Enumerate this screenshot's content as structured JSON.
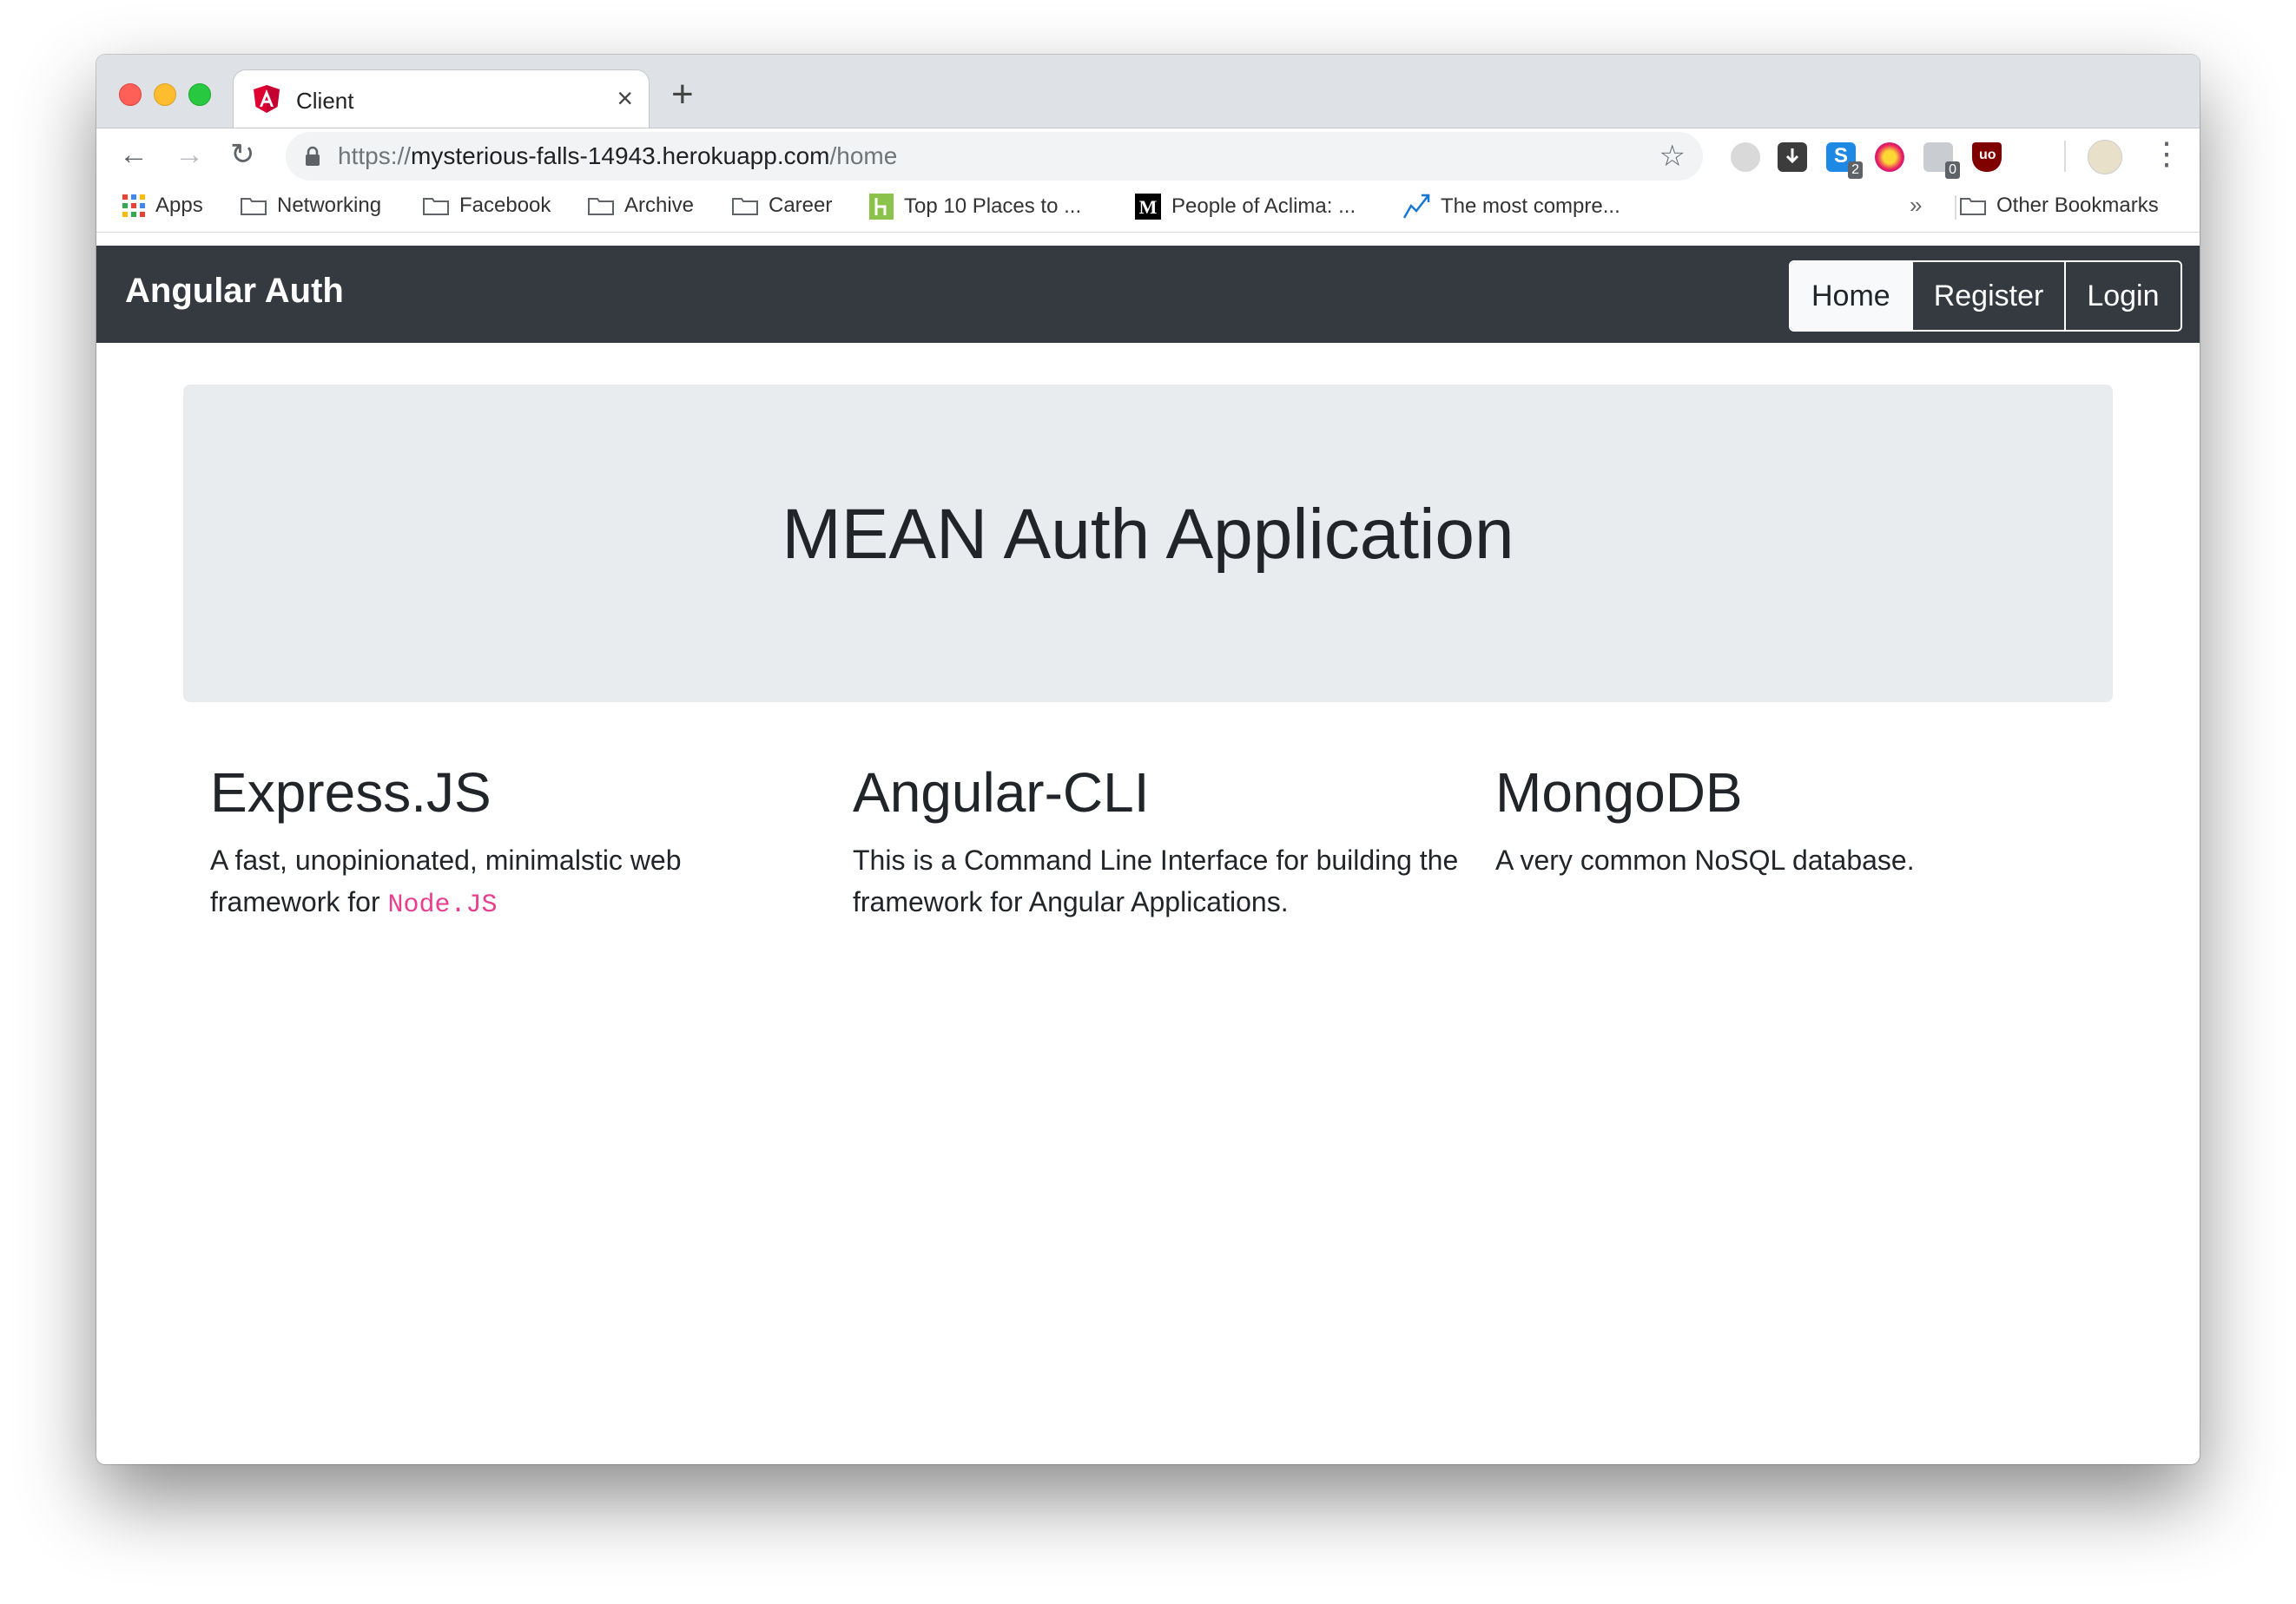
{
  "browser": {
    "tab_title": "Client",
    "tab_close": "×",
    "new_tab": "+",
    "url_scheme": "https://",
    "url_host": "mysterious-falls-14943.herokuapp.com",
    "url_path": "/home",
    "extension_badges": {
      "s": "2",
      "hands": "0"
    },
    "menu": "⋮"
  },
  "bookmarks": {
    "items": [
      {
        "label": "Apps",
        "icon": "apps-grid-icon"
      },
      {
        "label": "Networking",
        "icon": "folder-icon"
      },
      {
        "label": "Facebook",
        "icon": "folder-icon"
      },
      {
        "label": "Archive",
        "icon": "folder-icon"
      },
      {
        "label": "Career",
        "icon": "folder-icon"
      },
      {
        "label": "Top 10 Places to ...",
        "icon": "h-logo-icon"
      },
      {
        "label": "People of Aclima: ...",
        "icon": "medium-logo-icon"
      },
      {
        "label": "The most compre...",
        "icon": "chart-line-icon"
      }
    ],
    "overflow": "»",
    "other": "Other Bookmarks"
  },
  "navbar": {
    "brand": "Angular Auth",
    "links": [
      "Home",
      "Register",
      "Login"
    ]
  },
  "jumbotron": {
    "title": "MEAN Auth Application"
  },
  "features": [
    {
      "title": "Express.JS",
      "text": "A fast, unopinionated, minimalstic web framework for ",
      "code": "Node.JS"
    },
    {
      "title": "Angular-CLI",
      "text": "This is a Command Line Interface for building the framework for Angular Applications."
    },
    {
      "title": "MongoDB",
      "text": "A very common NoSQL database."
    }
  ],
  "colors": {
    "navbar_bg": "#343a40",
    "jumbotron_bg": "#e9ecef",
    "code_color": "#e83e8c"
  }
}
